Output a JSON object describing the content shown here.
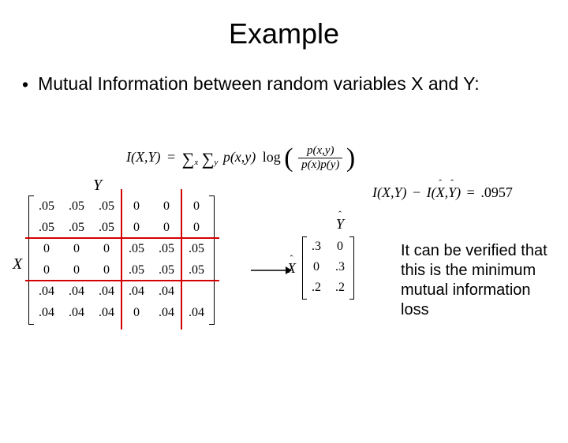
{
  "title": "Example",
  "bullet": "Mutual Information between random variables X and Y:",
  "formula": {
    "lhs": "I(X,Y)",
    "eq": "=",
    "sum1": "∑",
    "sum1sub": "x",
    "sum2": "∑",
    "sum2sub": "y",
    "px": "p(x,y)",
    "log": "log",
    "frac_num": "p(x,y)",
    "frac_den": "p(x)p(y)"
  },
  "bigmatrix": {
    "xlabel": "X",
    "ylabel": "Y",
    "rows": [
      [
        ".05",
        ".05",
        ".05",
        "0",
        "0",
        "0"
      ],
      [
        ".05",
        ".05",
        ".05",
        "0",
        "0",
        "0"
      ],
      [
        "0",
        "0",
        "0",
        ".05",
        ".05",
        ".05"
      ],
      [
        "0",
        "0",
        "0",
        ".05",
        ".05",
        ".05"
      ],
      [
        ".04",
        ".04",
        ".04",
        ".04",
        ".04",
        ""
      ],
      [
        ".04",
        ".04",
        ".04",
        "0",
        ".04",
        ".04"
      ]
    ]
  },
  "smallmatrix": {
    "xlabel": "X",
    "ylabel": "Y",
    "rows": [
      [
        ".3",
        "0"
      ],
      [
        "0",
        ".3"
      ],
      [
        ".2",
        ".2"
      ]
    ]
  },
  "result": {
    "lhs1": "I(X,Y)",
    "minus": "−",
    "lhs2": "I(X,Y)",
    "eq": "=",
    "val": ".0957"
  },
  "caption": "It can be verified that this is the minimum mutual information loss"
}
